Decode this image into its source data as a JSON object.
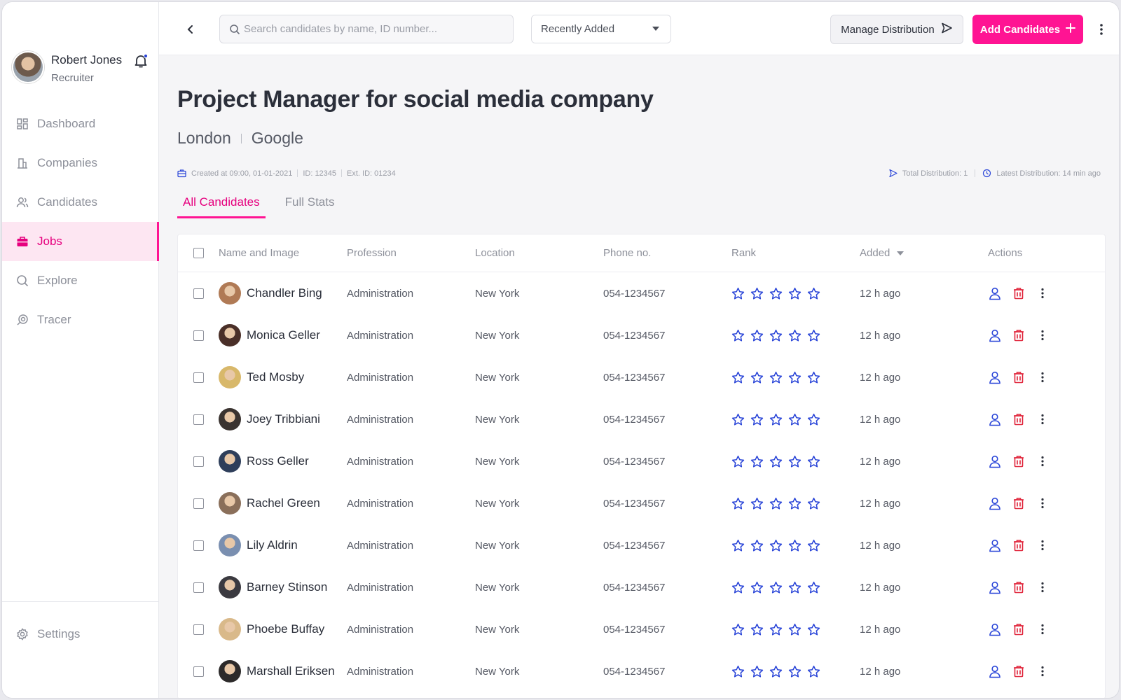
{
  "user": {
    "name": "Robert Jones",
    "role": "Recruiter"
  },
  "sidebar": {
    "items": [
      {
        "label": "Dashboard",
        "icon": "dashboard-icon"
      },
      {
        "label": "Companies",
        "icon": "building-icon"
      },
      {
        "label": "Candidates",
        "icon": "users-icon"
      },
      {
        "label": "Jobs",
        "icon": "briefcase-icon",
        "active": true
      },
      {
        "label": "Explore",
        "icon": "search-icon"
      },
      {
        "label": "Tracer",
        "icon": "tracer-icon"
      }
    ],
    "settings_label": "Settings"
  },
  "topbar": {
    "search_placeholder": "Search candidates by name, ID number...",
    "sort_value": "Recently Added",
    "manage_label": "Manage Distribution",
    "add_label": "Add Candidates"
  },
  "job": {
    "title": "Project Manager for social media company",
    "location": "London",
    "company": "Google",
    "created": "Created at 09:00, 01-01-2021",
    "id": "ID: 12345",
    "ext_id": "Ext. ID: 01234",
    "total_distribution": "Total Distribution: 1",
    "latest_distribution": "Latest Distribution: 14 min ago"
  },
  "tabs": [
    {
      "label": "All Candidates",
      "active": true
    },
    {
      "label": "Full Stats"
    }
  ],
  "table": {
    "headers": {
      "name": "Name and Image",
      "profession": "Profession",
      "location": "Location",
      "phone": "Phone no.",
      "rank": "Rank",
      "added": "Added",
      "actions": "Actions"
    },
    "rows": [
      {
        "name": "Chandler Bing",
        "profession": "Administration",
        "location": "New York",
        "phone": "054-1234567",
        "added": "12 h ago",
        "avatar_color": "#b07a55"
      },
      {
        "name": "Monica Geller",
        "profession": "Administration",
        "location": "New York",
        "phone": "054-1234567",
        "added": "12 h ago",
        "avatar_color": "#4a2f28"
      },
      {
        "name": "Ted Mosby",
        "profession": "Administration",
        "location": "New York",
        "phone": "054-1234567",
        "added": "12 h ago",
        "avatar_color": "#d8b86a"
      },
      {
        "name": "Joey Tribbiani",
        "profession": "Administration",
        "location": "New York",
        "phone": "054-1234567",
        "added": "12 h ago",
        "avatar_color": "#3a3330"
      },
      {
        "name": "Ross Geller",
        "profession": "Administration",
        "location": "New York",
        "phone": "054-1234567",
        "added": "12 h ago",
        "avatar_color": "#2e3e5a"
      },
      {
        "name": "Rachel Green",
        "profession": "Administration",
        "location": "New York",
        "phone": "054-1234567",
        "added": "12 h ago",
        "avatar_color": "#8a6f5a"
      },
      {
        "name": "Lily Aldrin",
        "profession": "Administration",
        "location": "New York",
        "phone": "054-1234567",
        "added": "12 h ago",
        "avatar_color": "#7a8fb0"
      },
      {
        "name": "Barney Stinson",
        "profession": "Administration",
        "location": "New York",
        "phone": "054-1234567",
        "added": "12 h ago",
        "avatar_color": "#3b3a40"
      },
      {
        "name": "Phoebe Buffay",
        "profession": "Administration",
        "location": "New York",
        "phone": "054-1234567",
        "added": "12 h ago",
        "avatar_color": "#d9b98a"
      },
      {
        "name": "Marshall Eriksen",
        "profession": "Administration",
        "location": "New York",
        "phone": "054-1234567",
        "added": "12 h ago",
        "avatar_color": "#2c2a2a"
      }
    ]
  },
  "colors": {
    "accent": "#ff1493",
    "star": "#2a45d8",
    "delete": "#e0243a",
    "profile_icon": "#2a45d8"
  }
}
